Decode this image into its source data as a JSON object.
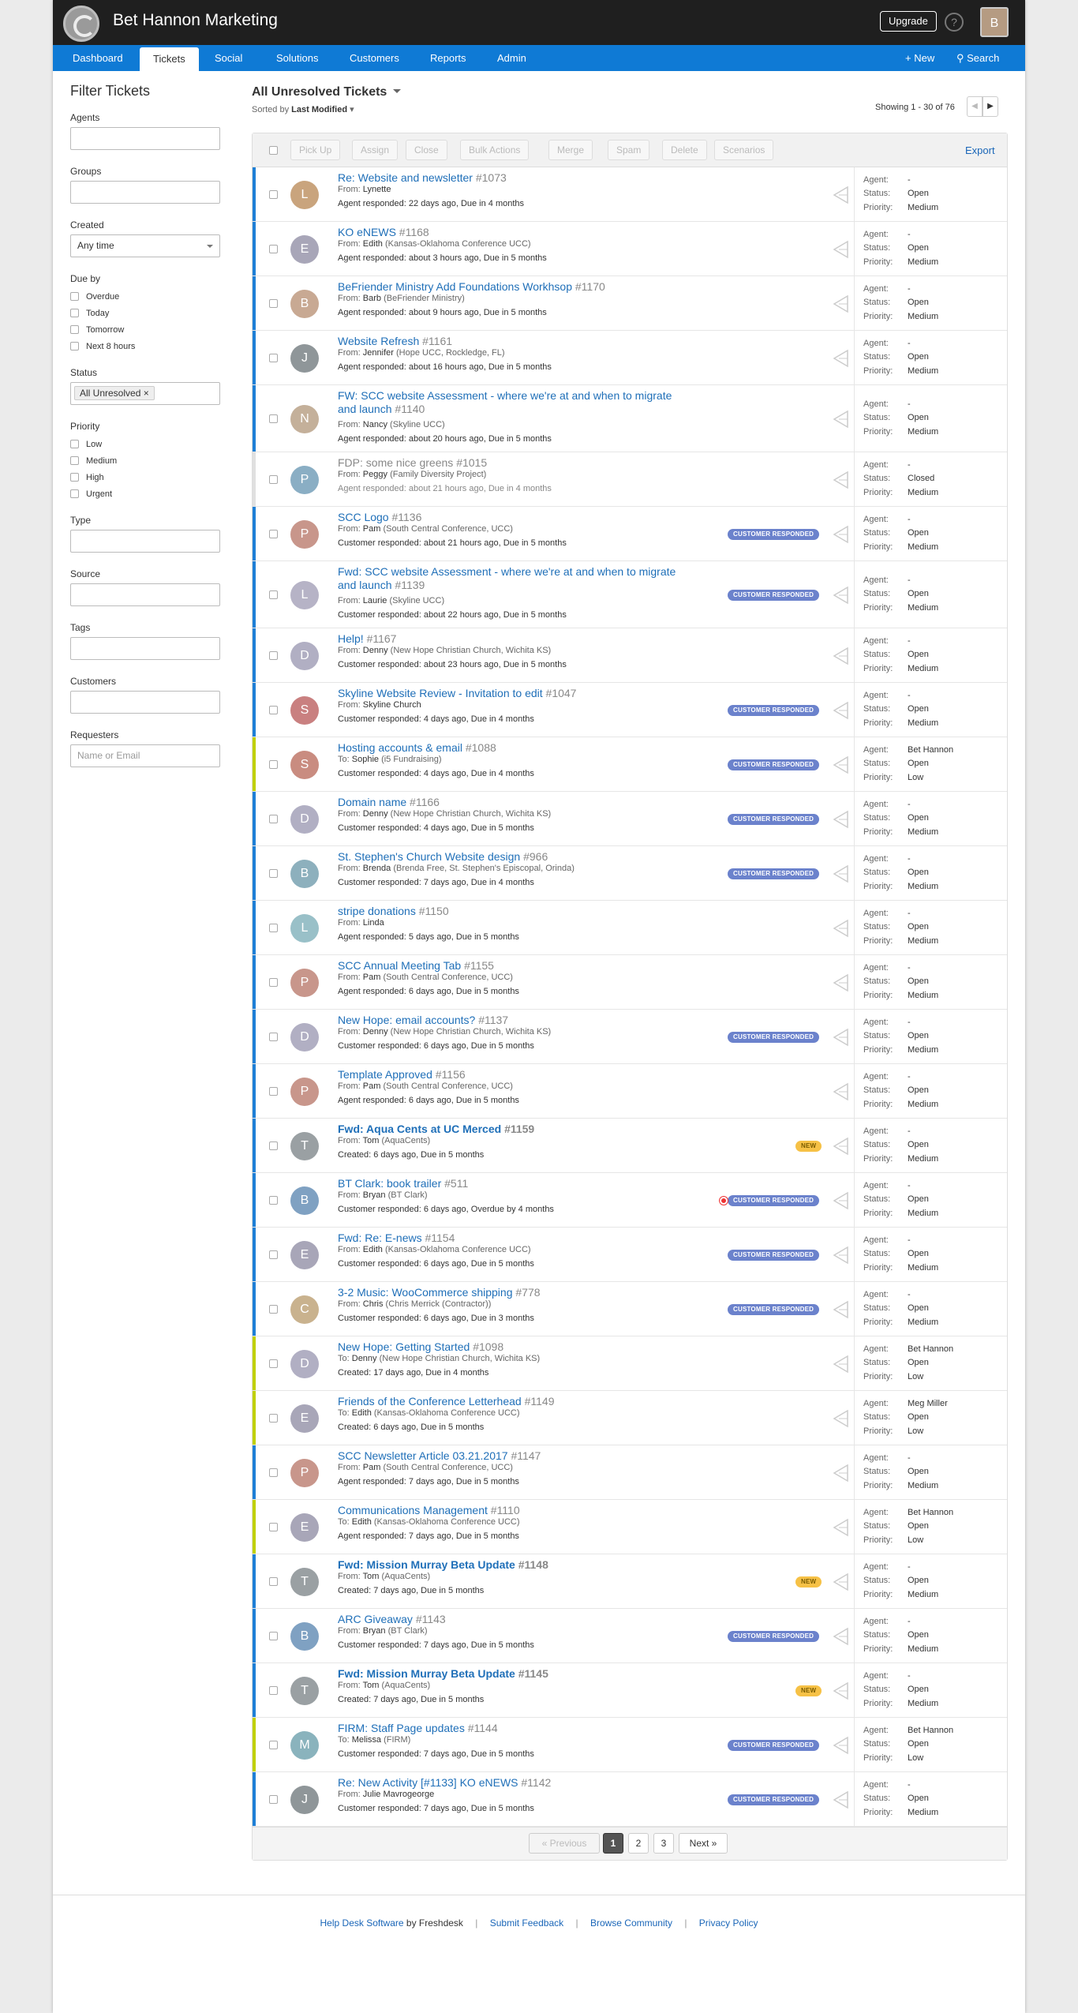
{
  "app": {
    "brand": "Bet Hannon Marketing",
    "upgrade": "Upgrade",
    "help": "?",
    "avatar_letter": "B"
  },
  "nav": {
    "items": [
      "Dashboard",
      "Tickets",
      "Social",
      "Solutions",
      "Customers",
      "Reports",
      "Admin"
    ],
    "new": "+ New",
    "search": "Search"
  },
  "sidebar": {
    "title": "Filter Tickets",
    "agents": "Agents",
    "groups": "Groups",
    "created": "Created",
    "created_value": "Any time",
    "due_by": "Due by",
    "due_opts": [
      "Overdue",
      "Today",
      "Tomorrow",
      "Next 8 hours"
    ],
    "status": "Status",
    "status_tag": "All Unresolved",
    "status_tag_close": "×",
    "priority": "Priority",
    "priority_opts": [
      "Low",
      "Medium",
      "High",
      "Urgent"
    ],
    "type": "Type",
    "source": "Source",
    "tags": "Tags",
    "customers": "Customers",
    "requesters": "Requesters",
    "requesters_placeholder": "Name or Email"
  },
  "view": {
    "title": "All Unresolved Tickets",
    "sorted_prefix": "Sorted by",
    "sorted_value": "Last Modified",
    "showing": "Showing 1 - 30 of 76",
    "prev_arrow": "◀",
    "next_arrow": "▶"
  },
  "toolbar": {
    "pickup": "Pick Up",
    "assign": "Assign",
    "close": "Close",
    "bulk": "Bulk Actions",
    "merge": "Merge",
    "spam": "Spam",
    "delete": "Delete",
    "scenarios": "Scenarios",
    "export": "Export"
  },
  "labels": {
    "agent": "Agent:",
    "status": "Status:",
    "priority": "Priority:",
    "cr": "CUSTOMER RESPONDED",
    "new": "NEW"
  },
  "colors": {
    "unassigned_bar": "#1e7fd6",
    "assigned_bar": "#c0d000",
    "closed_bar": "#e0e0e0"
  },
  "tickets": [
    {
      "subject": "Re: Website and newsletter",
      "num": "#1073",
      "dir": "From:",
      "who": "Lynette",
      "org": "",
      "meta": "Agent responded: 22 days ago, Due in 4 months",
      "agent": "-",
      "status": "Open",
      "priority": "Medium",
      "letter": "L",
      "avatar": "#c9a47d",
      "bar": "blue"
    },
    {
      "subject": "KO eNEWS",
      "num": "#1168",
      "dir": "From:",
      "who": "Edith",
      "org": "(Kansas-Oklahoma Conference UCC)",
      "meta": "Agent responded: about 3 hours ago, Due in 5 months",
      "agent": "-",
      "status": "Open",
      "priority": "Medium",
      "letter": "E",
      "avatar": "#a8a6b8",
      "bar": "blue"
    },
    {
      "subject": "BeFriender Ministry Add Foundations Workhsop",
      "num": "#1170",
      "dir": "From:",
      "who": "Barb",
      "org": "(BeFriender Ministry)",
      "meta": "Agent responded: about 9 hours ago, Due in 5 months",
      "agent": "-",
      "status": "Open",
      "priority": "Medium",
      "letter": "B",
      "avatar": "#c8a993",
      "bar": "blue"
    },
    {
      "subject": "Website Refresh",
      "num": "#1161",
      "dir": "From:",
      "who": "Jennifer",
      "org": "(Hope UCC, Rockledge, FL)",
      "meta": "Agent responded: about 16 hours ago, Due in 5 months",
      "agent": "-",
      "status": "Open",
      "priority": "Medium",
      "letter": "J",
      "avatar": "#8f9699",
      "bar": "blue"
    },
    {
      "subject": "FW: SCC website Assessment - where we're at and when to migrate and launch",
      "num": "#1140",
      "dir": "From:",
      "who": "Nancy",
      "org": "(Skyline UCC)",
      "meta": "Agent responded: about 20 hours ago, Due in 5 months",
      "agent": "-",
      "status": "Open",
      "priority": "Medium",
      "letter": "N",
      "avatar": "#c4b09a",
      "bar": "blue",
      "two": true
    },
    {
      "subject": "FDP: some nice greens",
      "num": "#1015",
      "dir": "From:",
      "who": "Peggy",
      "org": "(Family Diversity Project)",
      "meta": "Agent responded: about 21 hours ago, Due in 4 months",
      "agent": "-",
      "status": "Closed",
      "priority": "Medium",
      "letter": "P",
      "avatar": "#8aaec4",
      "bar": "closed",
      "closed": true
    },
    {
      "subject": "SCC Logo",
      "num": "#1136",
      "dir": "From:",
      "who": "Pam",
      "org": "(South Central Conference, UCC)",
      "meta": "Customer responded: about 21 hours ago, Due in 5 months",
      "agent": "-",
      "status": "Open",
      "priority": "Medium",
      "letter": "P",
      "avatar": "#c8968b",
      "bar": "blue",
      "cr": true
    },
    {
      "subject": "Fwd: SCC website Assessment - where we're at and when to migrate and launch",
      "num": "#1139",
      "dir": "From:",
      "who": "Laurie",
      "org": "(Skyline UCC)",
      "meta": "Customer responded: about 22 hours ago, Due in 5 months",
      "agent": "-",
      "status": "Open",
      "priority": "Medium",
      "letter": "L",
      "avatar": "#b6b3c6",
      "bar": "blue",
      "cr": true,
      "two": true
    },
    {
      "subject": "Help!",
      "num": "#1167",
      "dir": "From:",
      "who": "Denny",
      "org": "(New Hope Christian Church, Wichita KS)",
      "meta": "Customer responded: about 23 hours ago, Due in 5 months",
      "agent": "-",
      "status": "Open",
      "priority": "Medium",
      "letter": "D",
      "avatar": "#b1afc3",
      "bar": "blue"
    },
    {
      "subject": "Skyline Website Review - Invitation to edit",
      "num": "#1047",
      "dir": "From:",
      "who": "Skyline Church",
      "org": "",
      "meta": "Customer responded: 4 days ago, Due in 4 months",
      "agent": "-",
      "status": "Open",
      "priority": "Medium",
      "letter": "S",
      "avatar": "#c98080",
      "bar": "blue",
      "cr": true
    },
    {
      "subject": "Hosting accounts & email",
      "num": "#1088",
      "dir": "To:",
      "who": "Sophie",
      "org": "(i5 Fundraising)",
      "meta": "Customer responded: 4 days ago, Due in 4 months",
      "agent": "Bet Hannon",
      "status": "Open",
      "priority": "Low",
      "letter": "S",
      "avatar": "#c98c80",
      "bar": "green",
      "cr": true
    },
    {
      "subject": "Domain name",
      "num": "#1166",
      "dir": "From:",
      "who": "Denny",
      "org": "(New Hope Christian Church, Wichita KS)",
      "meta": "Customer responded: 4 days ago, Due in 5 months",
      "agent": "-",
      "status": "Open",
      "priority": "Medium",
      "letter": "D",
      "avatar": "#b1afc3",
      "bar": "blue",
      "cr": true
    },
    {
      "subject": "St. Stephen's Church Website design",
      "num": "#966",
      "dir": "From:",
      "who": "Brenda",
      "org": "(Brenda Free, St. Stephen's Episcopal, Orinda)",
      "meta": "Customer responded: 7 days ago, Due in 4 months",
      "agent": "-",
      "status": "Open",
      "priority": "Medium",
      "letter": "B",
      "avatar": "#8db0bd",
      "bar": "blue",
      "cr": true
    },
    {
      "subject": "stripe donations",
      "num": "#1150",
      "dir": "From:",
      "who": "Linda",
      "org": "",
      "meta": "Agent responded: 5 days ago, Due in 5 months",
      "agent": "-",
      "status": "Open",
      "priority": "Medium",
      "letter": "L",
      "avatar": "#99c0c8",
      "bar": "blue"
    },
    {
      "subject": "SCC Annual Meeting Tab",
      "num": "#1155",
      "dir": "From:",
      "who": "Pam",
      "org": "(South Central Conference, UCC)",
      "meta": "Agent responded: 6 days ago, Due in 5 months",
      "agent": "-",
      "status": "Open",
      "priority": "Medium",
      "letter": "P",
      "avatar": "#c8968b",
      "bar": "blue"
    },
    {
      "subject": "New Hope: email accounts?",
      "num": "#1137",
      "dir": "From:",
      "who": "Denny",
      "org": "(New Hope Christian Church, Wichita KS)",
      "meta": "Customer responded: 6 days ago, Due in 5 months",
      "agent": "-",
      "status": "Open",
      "priority": "Medium",
      "letter": "D",
      "avatar": "#b1afc3",
      "bar": "blue",
      "cr": true
    },
    {
      "subject": "Template Approved",
      "num": "#1156",
      "dir": "From:",
      "who": "Pam",
      "org": "(South Central Conference, UCC)",
      "meta": "Agent responded: 6 days ago, Due in 5 months",
      "agent": "-",
      "status": "Open",
      "priority": "Medium",
      "letter": "P",
      "avatar": "#c8968b",
      "bar": "blue"
    },
    {
      "subject": "Fwd: Aqua Cents at UC Merced",
      "num": "#1159",
      "dir": "From:",
      "who": "Tom",
      "org": "(AquaCents)",
      "meta": "Created: 6 days ago, Due in 5 months",
      "agent": "-",
      "status": "Open",
      "priority": "Medium",
      "letter": "T",
      "avatar": "#9aa0a3",
      "bar": "blue",
      "isnew": true,
      "bold": true
    },
    {
      "subject": "BT Clark: book trailer",
      "num": "#511",
      "dir": "From:",
      "who": "Bryan",
      "org": "(BT Clark)",
      "meta": "Customer responded: 6 days ago, Overdue by 4 months",
      "agent": "-",
      "status": "Open",
      "priority": "Medium",
      "letter": "B",
      "avatar": "#7fa1c2",
      "bar": "blue",
      "cr": true,
      "dot": true
    },
    {
      "subject": "Fwd: Re: E-news",
      "num": "#1154",
      "dir": "From:",
      "who": "Edith",
      "org": "(Kansas-Oklahoma Conference UCC)",
      "meta": "Customer responded: 6 days ago, Due in 5 months",
      "agent": "-",
      "status": "Open",
      "priority": "Medium",
      "letter": "E",
      "avatar": "#a8a6b8",
      "bar": "blue",
      "cr": true
    },
    {
      "subject": "3-2 Music: WooCommerce shipping",
      "num": "#778",
      "dir": "From:",
      "who": "Chris",
      "org": "(Chris Merrick (Contractor))",
      "meta": "Customer responded: 6 days ago, Due in 3 months",
      "agent": "-",
      "status": "Open",
      "priority": "Medium",
      "letter": "C",
      "avatar": "#c9b28e",
      "bar": "blue",
      "cr": true
    },
    {
      "subject": "New Hope: Getting Started",
      "num": "#1098",
      "dir": "To:",
      "who": "Denny",
      "org": "(New Hope Christian Church, Wichita KS)",
      "meta": "Created: 17 days ago, Due in 4 months",
      "agent": "Bet Hannon",
      "status": "Open",
      "priority": "Low",
      "letter": "D",
      "avatar": "#b1afc3",
      "bar": "green"
    },
    {
      "subject": "Friends of the Conference Letterhead",
      "num": "#1149",
      "dir": "To:",
      "who": "Edith",
      "org": "(Kansas-Oklahoma Conference UCC)",
      "meta": "Created: 6 days ago, Due in 5 months",
      "agent": "Meg Miller",
      "status": "Open",
      "priority": "Low",
      "letter": "E",
      "avatar": "#a8a6b8",
      "bar": "green"
    },
    {
      "subject": "SCC Newsletter Article 03.21.2017",
      "num": "#1147",
      "dir": "From:",
      "who": "Pam",
      "org": "(South Central Conference, UCC)",
      "meta": "Agent responded: 7 days ago, Due in 5 months",
      "agent": "-",
      "status": "Open",
      "priority": "Medium",
      "letter": "P",
      "avatar": "#c8968b",
      "bar": "blue"
    },
    {
      "subject": "Communications Management",
      "num": "#1110",
      "dir": "To:",
      "who": "Edith",
      "org": "(Kansas-Oklahoma Conference UCC)",
      "meta": "Agent responded: 7 days ago, Due in 5 months",
      "agent": "Bet Hannon",
      "status": "Open",
      "priority": "Low",
      "letter": "E",
      "avatar": "#a8a6b8",
      "bar": "green"
    },
    {
      "subject": "Fwd: Mission Murray Beta Update",
      "num": "#1148",
      "dir": "From:",
      "who": "Tom",
      "org": "(AquaCents)",
      "meta": "Created: 7 days ago, Due in 5 months",
      "agent": "-",
      "status": "Open",
      "priority": "Medium",
      "letter": "T",
      "avatar": "#9aa0a3",
      "bar": "blue",
      "isnew": true,
      "bold": true
    },
    {
      "subject": "ARC Giveaway",
      "num": "#1143",
      "dir": "From:",
      "who": "Bryan",
      "org": "(BT Clark)",
      "meta": "Customer responded: 7 days ago, Due in 5 months",
      "agent": "-",
      "status": "Open",
      "priority": "Medium",
      "letter": "B",
      "avatar": "#7fa1c2",
      "bar": "blue",
      "cr": true
    },
    {
      "subject": "Fwd: Mission Murray Beta Update",
      "num": "#1145",
      "dir": "From:",
      "who": "Tom",
      "org": "(AquaCents)",
      "meta": "Created: 7 days ago, Due in 5 months",
      "agent": "-",
      "status": "Open",
      "priority": "Medium",
      "letter": "T",
      "avatar": "#9aa0a3",
      "bar": "blue",
      "isnew": true,
      "bold": true
    },
    {
      "subject": "FIRM: Staff Page updates",
      "num": "#1144",
      "dir": "To:",
      "who": "Melissa",
      "org": "(FIRM)",
      "meta": "Customer responded: 7 days ago, Due in 5 months",
      "agent": "Bet Hannon",
      "status": "Open",
      "priority": "Low",
      "letter": "M",
      "avatar": "#8ab3bd",
      "bar": "green",
      "cr": true
    },
    {
      "subject": "Re: New Activity [#1133] KO eNEWS",
      "num": "#1142",
      "dir": "From:",
      "who": "Julie Mavrogeorge",
      "org": "",
      "meta": "Customer responded: 7 days ago, Due in 5 months",
      "agent": "-",
      "status": "Open",
      "priority": "Medium",
      "letter": "J",
      "avatar": "#8f9699",
      "bar": "blue",
      "cr": true
    }
  ],
  "pager": {
    "prev": "« Previous",
    "pages": [
      "1",
      "2",
      "3"
    ],
    "next": "Next »"
  },
  "footer": {
    "hds": "Help Desk Software",
    "by": " by Freshdesk",
    "sep": "|",
    "feedback": "Submit Feedback",
    "community": "Browse Community",
    "privacy": "Privacy Policy"
  }
}
